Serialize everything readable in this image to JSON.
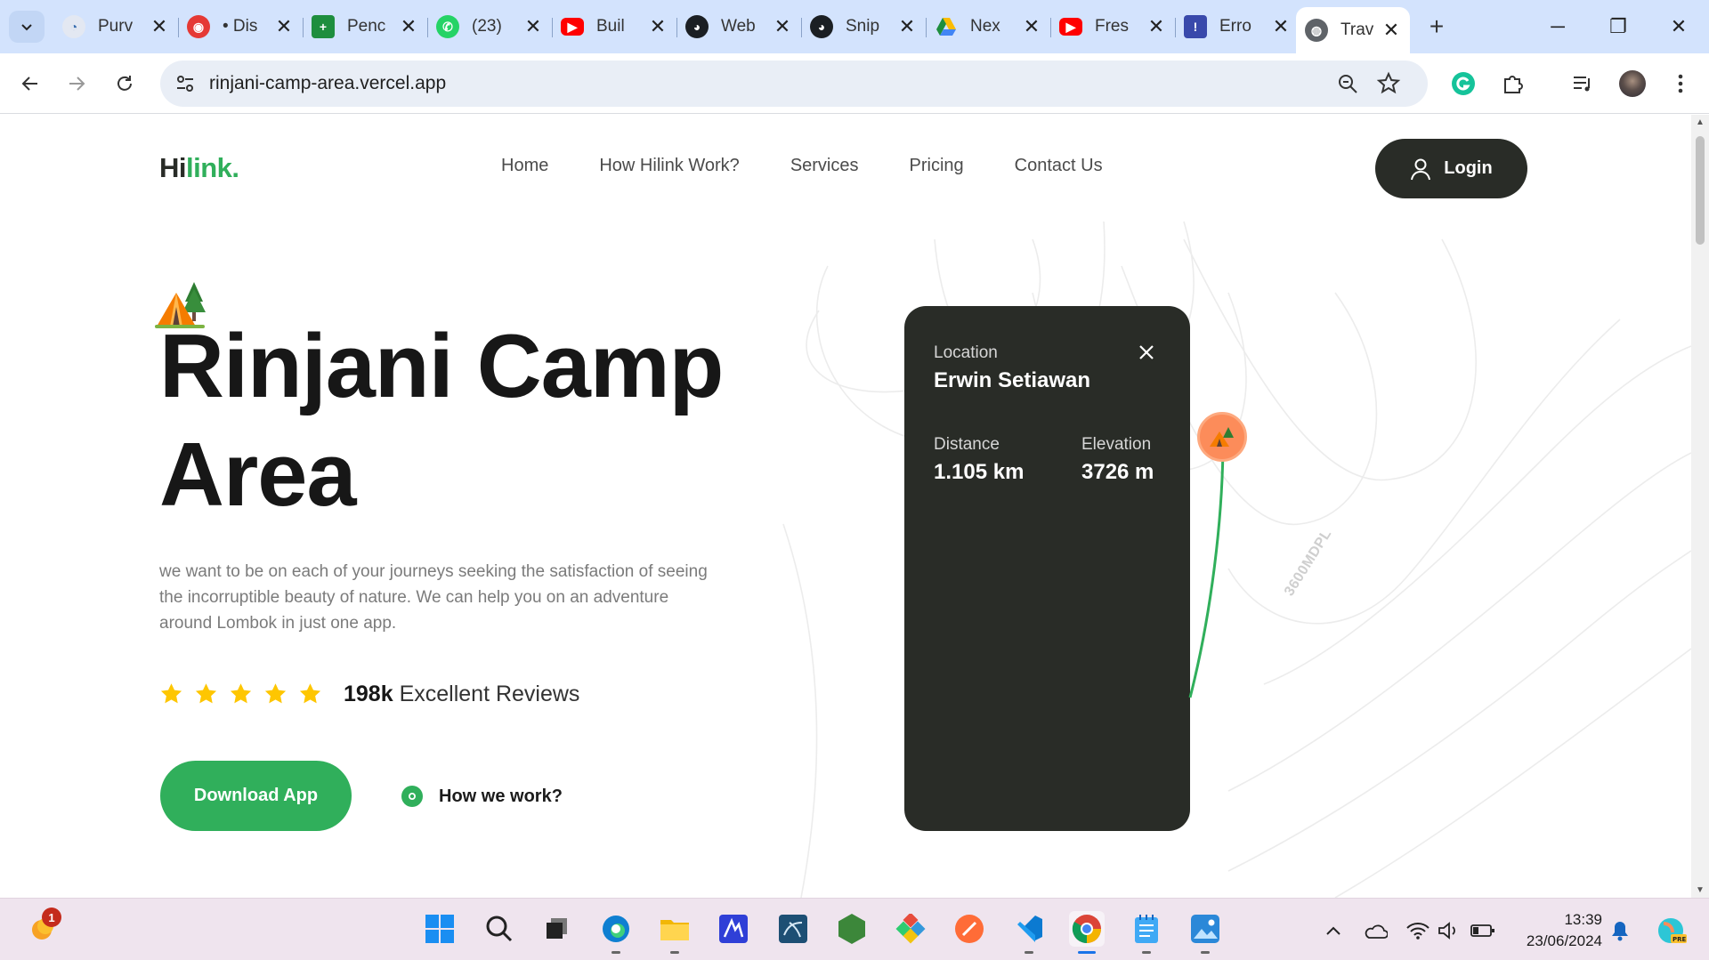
{
  "browser": {
    "tabs": [
      {
        "title": "Purv",
        "icon": "purview-icon",
        "color": "#3a6fb0"
      },
      {
        "title": "• Dis",
        "icon": "discord-icon",
        "color": "#e53935"
      },
      {
        "title": "Penc",
        "icon": "sheets-icon",
        "color": "#1e8e3e"
      },
      {
        "title": "(23)",
        "icon": "whatsapp-icon",
        "color": "#25d366"
      },
      {
        "title": "Buil",
        "icon": "youtube-icon",
        "color": "#ff0000"
      },
      {
        "title": "Web",
        "icon": "github-icon",
        "color": "#1b1f23"
      },
      {
        "title": "Snip",
        "icon": "github-icon",
        "color": "#1b1f23"
      },
      {
        "title": "Nex",
        "icon": "drive-icon",
        "color": "#fbbc04"
      },
      {
        "title": "Fres",
        "icon": "youtube-icon",
        "color": "#ff0000"
      },
      {
        "title": "Erro",
        "icon": "error-page-icon",
        "color": "#3949ab"
      },
      {
        "title": "Trav",
        "icon": "globe-icon",
        "color": "#5f6368"
      }
    ],
    "url": "rinjani-camp-area.vercel.app"
  },
  "site": {
    "logo_main": "Hi",
    "logo_accent": "link.",
    "nav": [
      "Home",
      "How Hilink Work?",
      "Services",
      "Pricing",
      "Contact Us"
    ],
    "login_label": "Login",
    "hero": {
      "title": "Rinjani Camp Area",
      "description": "we want to be on each of your journeys seeking the satisfaction of seeing the incorruptible beauty of nature. We can help you on an adventure around Lombok in just one app.",
      "rating_stars": 5,
      "reviews_count": "198k",
      "reviews_label": "Excellent Reviews",
      "download_label": "Download App",
      "how_label": "How we work?"
    },
    "card": {
      "location_label": "Location",
      "location_value": "Erwin Setiawan",
      "distance_label": "Distance",
      "distance_value": "1.105 km",
      "elevation_label": "Elevation",
      "elevation_value": "3726 m"
    },
    "map_label": "3600MDPL",
    "colors": {
      "accent": "#30af5b",
      "dark": "#292c27",
      "pin": "#fc8c5a"
    }
  },
  "taskbar": {
    "notification_count": "1",
    "time": "13:39",
    "date": "23/06/2024"
  }
}
